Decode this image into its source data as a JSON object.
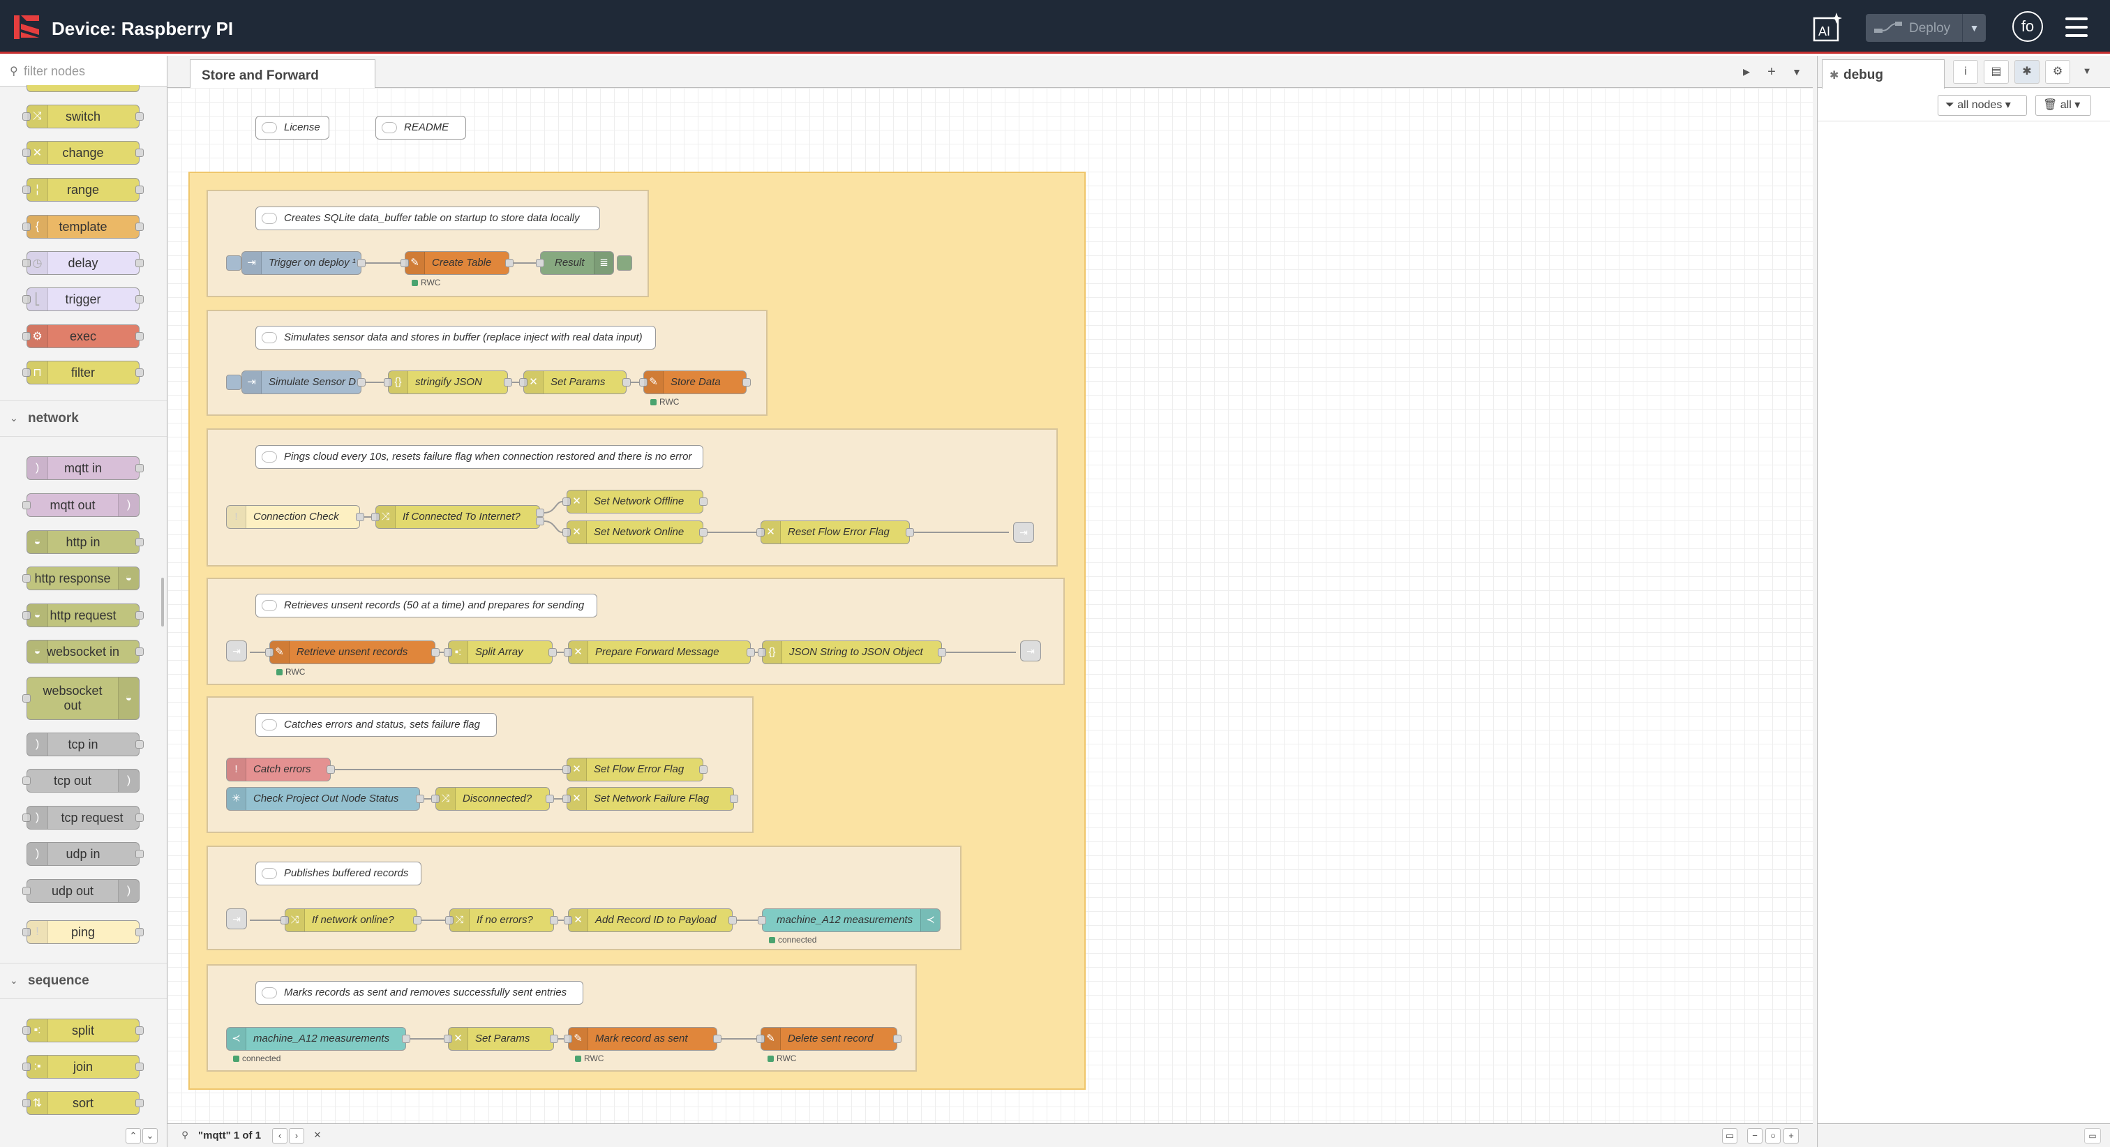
{
  "header": {
    "title": "Device: Raspberry PI",
    "deploy_label": "Deploy",
    "user_initials": "fo",
    "accent_color": "#c53030"
  },
  "palette": {
    "search_placeholder": "filter nodes",
    "function_nodes": [
      "switch",
      "change",
      "range",
      "template",
      "delay",
      "trigger",
      "exec",
      "filter"
    ],
    "categories": {
      "network": "network",
      "sequence": "sequence"
    },
    "network_nodes": [
      "mqtt in",
      "mqtt out",
      "http in",
      "http response",
      "http request",
      "websocket in",
      "websocket out",
      "tcp in",
      "tcp out",
      "tcp request",
      "udp in",
      "udp out",
      "ping"
    ],
    "sequence_nodes": [
      "split",
      "join",
      "sort"
    ]
  },
  "workspace": {
    "tab_label": "Store and Forward",
    "search_label": "\"mqtt\" 1 of 1"
  },
  "flow": {
    "top_comments": {
      "license": "License",
      "readme": "README"
    },
    "groups": [
      {
        "comment": "Creates SQLite data_buffer table on startup to store data locally",
        "nodes": {
          "trigger": "Trigger on deploy ¹",
          "create_table": "Create Table",
          "result": "Result"
        },
        "status": "RWC"
      },
      {
        "comment": "Simulates sensor data and stores in buffer (replace inject with real data input)",
        "nodes": {
          "simulate": "Simulate Sensor D",
          "stringify": "stringify JSON",
          "set_params": "Set Params",
          "store_data": "Store Data"
        },
        "status": "RWC"
      },
      {
        "comment": "Pings cloud every 10s, resets failure flag when connection restored and there is no error",
        "nodes": {
          "connection_check": "Connection Check",
          "if_connected": "If Connected To Internet?",
          "set_offline": "Set Network Offline",
          "set_online": "Set Network Online",
          "reset_flag": "Reset Flow Error Flag"
        }
      },
      {
        "comment": "Retrieves unsent records (50 at a time) and prepares for sending",
        "nodes": {
          "retrieve": "Retrieve unsent records",
          "split": "Split Array",
          "prepare": "Prepare Forward Message",
          "json": "JSON String to JSON Object"
        },
        "status": "RWC"
      },
      {
        "comment": "Catches errors and status, sets failure flag",
        "nodes": {
          "catch": "Catch errors",
          "set_flow_error": "Set Flow Error Flag",
          "check_status": "Check Project Out Node Status",
          "disconnected": "Disconnected?",
          "set_failure": "Set Network Failure Flag"
        }
      },
      {
        "comment": "Publishes buffered records",
        "nodes": {
          "if_online": "If network online?",
          "if_no_errors": "If no errors?",
          "add_id": "Add Record ID to Payload",
          "mqtt_out": "machine_A12 measurements"
        },
        "status": "connected"
      },
      {
        "comment": "Marks records as sent and removes successfully sent entries",
        "nodes": {
          "mqtt_in": "machine_A12 measurements",
          "set_params": "Set Params",
          "mark_sent": "Mark record as sent",
          "delete_sent": "Delete sent record"
        },
        "status_connected": "connected",
        "status_rwc": "RWC"
      }
    ]
  },
  "sidebar": {
    "tab_label": "debug",
    "filter_nodes": "all nodes",
    "filter_all": "all"
  },
  "colors": {
    "switch": "#e2d96e",
    "change": "#e2d96e",
    "function": "#e2d96e",
    "template": "#ebb866",
    "delay": "#e6e0f8",
    "trigger": "#e6e0f8",
    "exec": "#e07f6a",
    "filter": "#e2d96e",
    "mqtt": "#d8bfd8",
    "http": "#c0c47e",
    "tcp": "#c0c0c0",
    "ping": "#fdf0c2",
    "sqlite": "#e0863b",
    "inject": "#a6bbcf",
    "debug": "#87a980",
    "catch": "#e49191",
    "status": "#94c1d0",
    "mqtt_ff": "#80cbc4"
  }
}
